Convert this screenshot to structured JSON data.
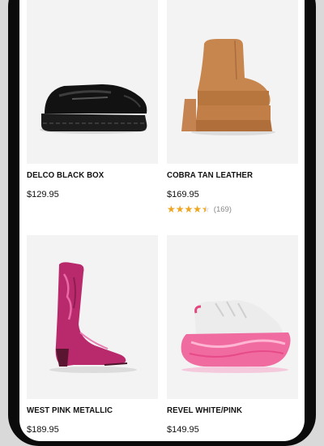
{
  "products": [
    {
      "name": "DELCO BLACK BOX",
      "price": "$129.95"
    },
    {
      "name": "COBRA TAN LEATHER",
      "price": "$169.95",
      "rating": 4.5,
      "review_count": "(169)"
    },
    {
      "name": "WEST PINK METALLIC",
      "price": "$189.95"
    },
    {
      "name": "REVEL WHITE/PINK",
      "price": "$149.95"
    }
  ],
  "colors": {
    "star": "#f0a51e",
    "image_bg": "#f3f3f3",
    "text": "#111111"
  },
  "icons": [
    "shoe-image",
    "star-rating-icon"
  ]
}
